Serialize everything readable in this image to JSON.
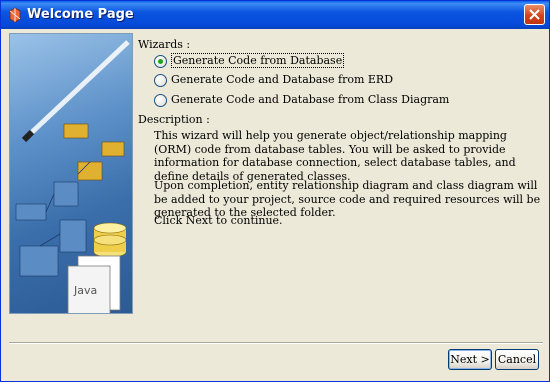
{
  "window": {
    "title": "Welcome Page"
  },
  "wizards": {
    "label": "Wizards :",
    "options": [
      {
        "label": "Generate Code from Database",
        "checked": true
      },
      {
        "label": "Generate Code and Database from ERD",
        "checked": false
      },
      {
        "label": "Generate Code and Database from Class Diagram",
        "checked": false
      }
    ]
  },
  "description": {
    "label": "Description :",
    "paragraphs": [
      "This wizard will help you generate object/relationship mapping (ORM) code from database tables. You will be asked to provide information for database connection, select database tables, and define details of generated classes.",
      "Upon completion, entity relationship diagram and class diagram will be added to your project, source code and required resources will be generated to the selected folder.",
      "Click Next to continue."
    ]
  },
  "banner": {
    "file_label": "Java"
  },
  "buttons": {
    "next": "Next >",
    "cancel": "Cancel"
  },
  "colors": {
    "title_bar": "#0b55e0",
    "close_button": "#d4441c",
    "radio_checked": "#21a121"
  }
}
